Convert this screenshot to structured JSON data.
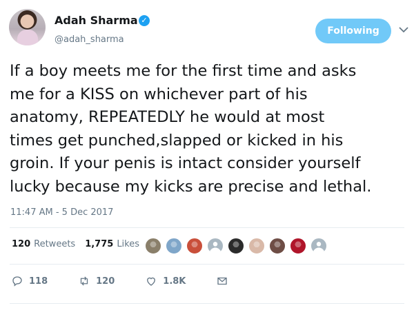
{
  "user": {
    "name": "Adah Sharma",
    "handle": "@adah_sharma"
  },
  "follow_button": {
    "label": "Following"
  },
  "tweet": {
    "text": "If a boy meets me for the first time and asks\nme for a KISS on whichever part of his\nanatomy, REPEATEDLY he would at most\ntimes get punched,slapped or kicked in his\ngroin. If your penis is intact consider yourself\nlucky because my kicks are precise and lethal.",
    "timestamp": "11:47 AM - 5 Dec 2017"
  },
  "stats": {
    "retweets_count": "120",
    "retweets_label": "Retweets",
    "likes_count": "1,775",
    "likes_label": "Likes"
  },
  "actions": {
    "reply_count": "118",
    "retweet_count": "120",
    "like_count": "1.8K"
  },
  "colors": {
    "accent": "#1da1f2",
    "follow_button_bg": "#71c9f8",
    "secondary_text": "#657786"
  },
  "likers": [
    {
      "icon": "avatar-image",
      "color": "#8a7f6a"
    },
    {
      "icon": "avatar-image",
      "color": "#7fa6c9"
    },
    {
      "icon": "avatar-image",
      "color": "#c94f3a"
    },
    {
      "icon": "default-avatar",
      "color": "#aab8c2"
    },
    {
      "icon": "avatar-image",
      "color": "#2b2b2b"
    },
    {
      "icon": "avatar-image",
      "color": "#d9b9a8"
    },
    {
      "icon": "avatar-image",
      "color": "#6e4d45"
    },
    {
      "icon": "avatar-image",
      "color": "#b0152a"
    },
    {
      "icon": "default-avatar",
      "color": "#aab8c2"
    }
  ]
}
